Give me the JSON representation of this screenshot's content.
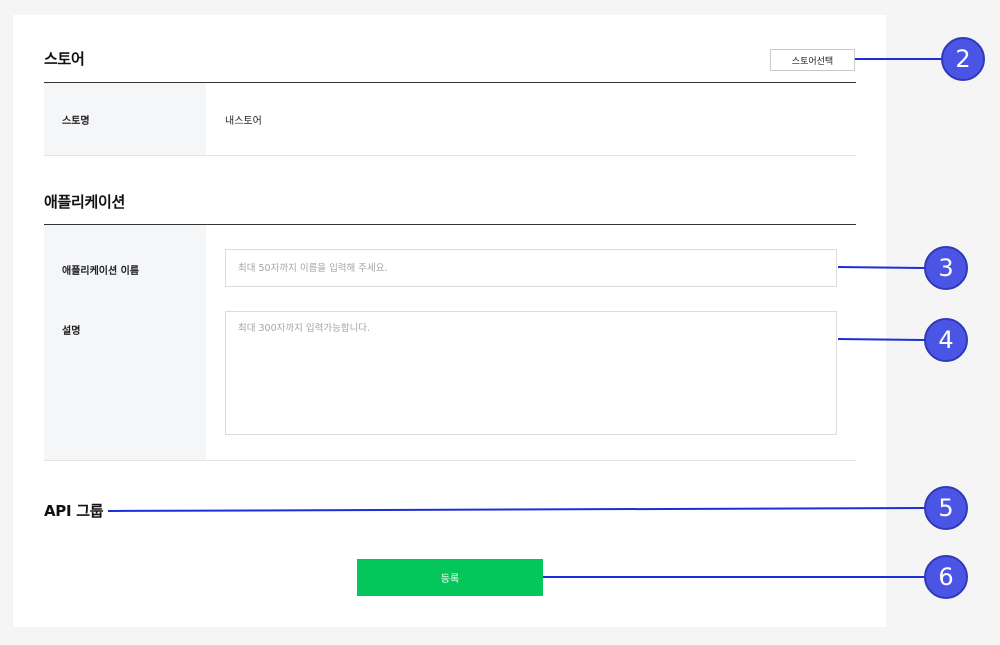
{
  "store": {
    "title": "스토어",
    "select_button": "스토어선택",
    "name_label": "스토명",
    "name_value": "내스토어"
  },
  "application": {
    "title": "애플리케이션",
    "name_label": "애플리케이션 이름",
    "name_placeholder": "최대 50자까지 이름을 입력해 주세요.",
    "description_label": "설명",
    "description_placeholder": "최대 300자까지 입력가능합니다."
  },
  "api_group": {
    "title": "API 그룹"
  },
  "submit_label": "등록",
  "callouts": [
    "2",
    "3",
    "4",
    "5",
    "6"
  ],
  "colors": {
    "accent_green": "#03c75a",
    "callout_blue": "#4a55e6",
    "connector_blue": "#1f2fd6"
  }
}
